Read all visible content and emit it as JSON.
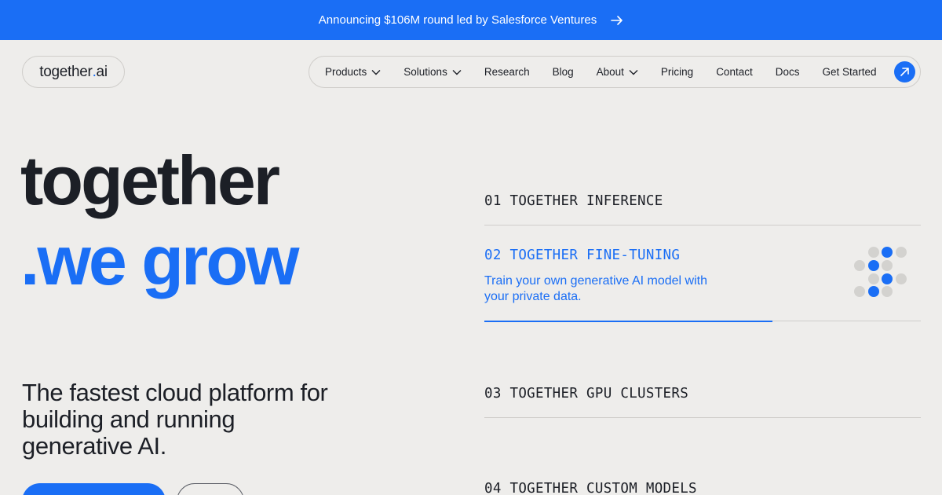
{
  "banner": {
    "text": "Announcing $106M round led by Salesforce Ventures",
    "arrow_icon": "arrow-right-icon"
  },
  "logo": {
    "prefix": "together",
    "dot": ".",
    "suffix": "ai"
  },
  "nav": {
    "items": [
      {
        "label": "Products",
        "has_dropdown": true
      },
      {
        "label": "Solutions",
        "has_dropdown": true
      },
      {
        "label": "Research",
        "has_dropdown": false
      },
      {
        "label": "Blog",
        "has_dropdown": false
      },
      {
        "label": "About",
        "has_dropdown": true
      },
      {
        "label": "Pricing",
        "has_dropdown": false
      },
      {
        "label": "Contact",
        "has_dropdown": false
      },
      {
        "label": "Docs",
        "has_dropdown": false
      }
    ],
    "cta_label": "Get Started",
    "cta_icon": "arrow-up-right-icon"
  },
  "hero": {
    "line1": "together",
    "line2": ".we grow"
  },
  "tagline": "The fastest cloud platform for building and running generative AI.",
  "products": [
    {
      "title": "01 TOGETHER INFERENCE",
      "active": false
    },
    {
      "title": "02 TOGETHER FINE-TUNING",
      "active": true,
      "description": "Train your own generative AI model with your private data.",
      "progress": 0.66
    },
    {
      "title": "03 TOGETHER GPU CLUSTERS",
      "active": false
    },
    {
      "title": "04 TOGETHER CUSTOM MODELS",
      "active": false
    }
  ],
  "colors": {
    "accent": "#1a6ef5",
    "background": "#eeedeb",
    "text": "#1c1f26",
    "divider": "#cfcdca"
  },
  "dots_icon": "dot-grid-icon"
}
